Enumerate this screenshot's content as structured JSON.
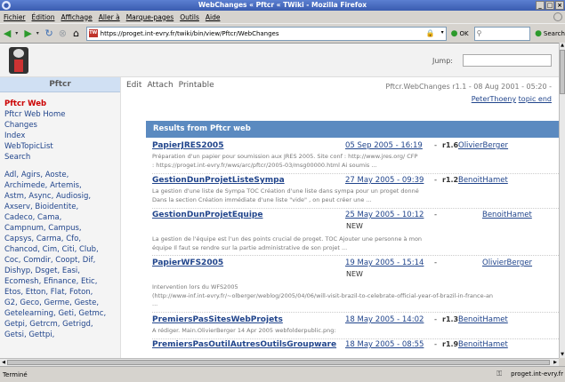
{
  "window": {
    "title": "WebChanges « Pftcr « TWiki - Mozilla Firefox",
    "buttons": [
      "_",
      "□",
      "×"
    ]
  },
  "menu": [
    "Fichier",
    "Édition",
    "Affichage",
    "Aller à",
    "Marque-pages",
    "Outils",
    "Aide"
  ],
  "nav": {
    "url": "https://proget.int-evry.fr/twiki/bin/view/Pftcr/WebChanges",
    "favicon": "TW",
    "go_label": "OK",
    "search_label": "Search",
    "icons": [
      "back-icon",
      "forward-icon",
      "reload-icon",
      "stop-icon",
      "home-icon"
    ]
  },
  "page": {
    "jump_label": "Jump:",
    "web_name": "Pftcr",
    "sidebar_links": [
      "Pftcr Web",
      "Pftcr Web Home",
      "Changes",
      "Index",
      "WebTopicList",
      "Search"
    ],
    "people": [
      "Adl, Agirs, Aoste,",
      "Archimede, Artemis,",
      "Astm, Async, Audiosig,",
      "Axserv, Bioidentite,",
      "Cadeco, Cama,",
      "Campnum, Campus,",
      "Capsys, Carma, Cfo,",
      "Chancod, Cim, Citi, Club,",
      "Coc, Comdir, Coopt, Dif,",
      "Dishyp, Dsget, Easi,",
      "Ecomesh, Efinance, Etic,",
      "Etos, Etton, Flat, Foton,",
      "G2, Geco, Germe, Geste,",
      "Getelearning, Geti, Getmc,",
      "Getpi, Getrcm, Getrigd,",
      "Getsi, Gettpi,"
    ],
    "actions": [
      "Edit",
      "Attach",
      "Printable"
    ],
    "revision": "Pftcr.WebChanges r1.1 - 08 Aug 2001 - 05:20 -",
    "revision_links": [
      "PeterThoeny",
      "topic end"
    ],
    "results_header": "Results from Pftcr web"
  },
  "hits": [
    {
      "title": "PapierJRES2005",
      "date": "05 Sep 2005 - 16:19",
      "sep": "-",
      "rev": "r1.6",
      "author": "OlivierBerger",
      "new": "",
      "summary": [
        "Préparation d'un papier pour soumission aux JRES 2005. Site conf : http://www.jres.org/ CFP",
        ": https://proget.int-evry.fr/wws/arc/pftcr/2005-03/msg00000.html Ai soumis ..."
      ]
    },
    {
      "title": "GestionDunProjetListeSympa",
      "date": "27 May 2005 - 09:39",
      "sep": "-",
      "rev": "r1.2",
      "author": "BenoitHamet",
      "new": "",
      "summary": [
        "La gestion d'une liste de Sympa TOC Création d'une liste dans sympa pour un proget donné",
        "Dans la section Création immédiate d'une liste \"vide\" , on peut créer une ..."
      ]
    },
    {
      "title": "GestionDunProjetEquipe",
      "date": "25 May 2005 - 10:12",
      "sep": "-",
      "rev": "",
      "author": "BenoitHamet",
      "new": "NEW",
      "summary": [
        "La gestion de l'équipe est l'un des points crucial de proget. TOC Ajouter une personne à mon",
        "équipe Il faut se rendre sur la partie administrative de son projet ..."
      ]
    },
    {
      "title": "PapierWFS2005",
      "date": "19 May 2005 - 15:14",
      "sep": "-",
      "rev": "",
      "author": "OlivierBerger",
      "new": "NEW",
      "summary": [
        "Intervention lors du WFS2005",
        "(http://www-inf.int-evry.fr/~olberger/weblog/2005/04/06/will-visit-brazil-to-celebrate-official-year-of-brazil-in-france-an",
        "..."
      ]
    },
    {
      "title": "PremiersPasSitesWebProjets",
      "date": "18 May 2005 - 14:02",
      "sep": "-",
      "rev": "r1.3",
      "author": "BenoitHamet",
      "new": "",
      "summary": [
        "A rédiger. Main.OlivierBerger 14 Apr 2005 webfolderpublic.png:"
      ]
    },
    {
      "title": "PremiersPasOutilAutresOutilsGroupware",
      "date": "18 May 2005 - 08:55",
      "sep": "-",
      "rev": "r1.9",
      "author": "BenoitHamet",
      "new": "",
      "summary": []
    }
  ],
  "status": {
    "left": "Terminé",
    "right": "proget.int-evry.fr"
  }
}
